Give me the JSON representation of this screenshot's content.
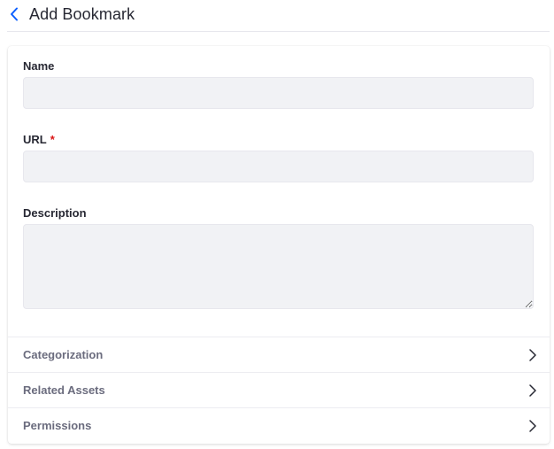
{
  "header": {
    "title": "Add Bookmark",
    "back_icon": "chevron-left-icon"
  },
  "form": {
    "name": {
      "label": "Name",
      "value": "",
      "placeholder": ""
    },
    "url": {
      "label": "URL",
      "required_mark": "*",
      "value": "",
      "placeholder": ""
    },
    "description": {
      "label": "Description",
      "value": "",
      "placeholder": ""
    }
  },
  "panels": [
    {
      "label": "Categorization",
      "icon": "chevron-right-icon"
    },
    {
      "label": "Related Assets",
      "icon": "chevron-right-icon"
    },
    {
      "label": "Permissions",
      "icon": "chevron-right-icon"
    }
  ],
  "colors": {
    "accent": "#0b5fff",
    "required": "#da1414",
    "input_bg": "#f1f2f5",
    "muted_text": "#6b6c7e"
  }
}
